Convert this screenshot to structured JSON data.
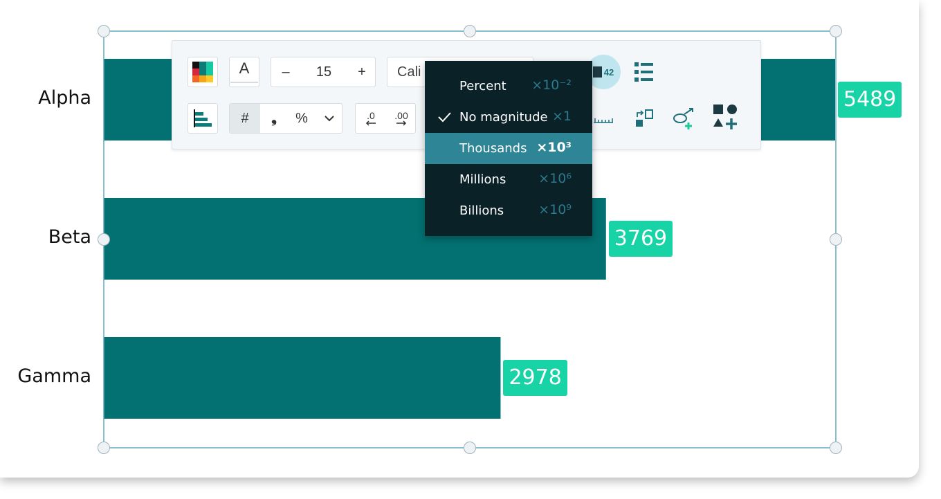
{
  "chart_data": {
    "type": "bar",
    "orientation": "horizontal",
    "categories": [
      "Alpha",
      "Beta",
      "Gamma"
    ],
    "values": [
      5489,
      3769,
      2978
    ],
    "bar_color": "#037171",
    "label_color": "#17d3a6",
    "xlim": [
      0,
      5489
    ],
    "grid": false,
    "title": "",
    "xlabel": "",
    "ylabel": ""
  },
  "toolbar": {
    "font_size": "15",
    "decrement": "–",
    "increment": "+",
    "font_name": "Cali",
    "text_color_label": "A",
    "number_format_hash": "#",
    "number_format_comma": "❟",
    "number_format_percent": "%",
    "decimal_decrease": ".0",
    "decimal_increase": ".00",
    "badge_count": "42",
    "accent_color": "#1d6f7a"
  },
  "magnitude_menu": {
    "items": [
      {
        "label": "Percent",
        "mag": "×10⁻²",
        "checked": false,
        "highlighted": false
      },
      {
        "label": "No magnitude",
        "mag": "×1",
        "checked": true,
        "highlighted": false
      },
      {
        "label": "Thousands",
        "mag": "×10³",
        "checked": false,
        "highlighted": true
      },
      {
        "label": "Millions",
        "mag": "×10⁶",
        "checked": false,
        "highlighted": false
      },
      {
        "label": "Billions",
        "mag": "×10⁹",
        "checked": false,
        "highlighted": false
      }
    ]
  }
}
